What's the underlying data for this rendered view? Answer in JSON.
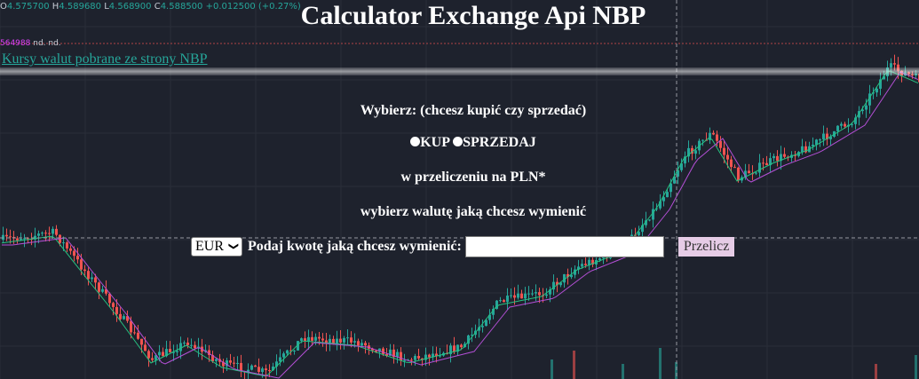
{
  "ticker": {
    "o_label": "O",
    "o_value": "4.575700",
    "h_label": "H",
    "h_value": "4.589680",
    "l_label": "L",
    "l_value": "4.568900",
    "c_label": "C",
    "c_value": "4.588500",
    "change": "+0.012500 (+0.27%)"
  },
  "indicator": {
    "value": "564988",
    "nd1": "nd.",
    "nd2": "nd."
  },
  "colors": {
    "up": "#26a69a",
    "down": "#ef5350",
    "ma_green": "#26c281",
    "ma_purple": "#b44fd6",
    "button_bg": "#e6cce6"
  },
  "page": {
    "title": "Calculator Exchange Api NBP",
    "source_link": "Kursy walut pobrane ze strony NBP"
  },
  "form": {
    "choose_label": "Wybierz: (chcesz kupić czy sprzedać)",
    "options": [
      {
        "label": "KUP",
        "selected": false
      },
      {
        "label": "SPRZEDAJ",
        "selected": false
      }
    ],
    "conversion_note": "w przeliczeniu na PLN*",
    "currency_prompt": "wybierz walutę jaką chcesz wymienić",
    "currency_selected": "EUR",
    "amount_label": "Podaj kwotę jaką chcesz wymienić:",
    "amount_value": "",
    "submit_label": "Przelicz"
  }
}
